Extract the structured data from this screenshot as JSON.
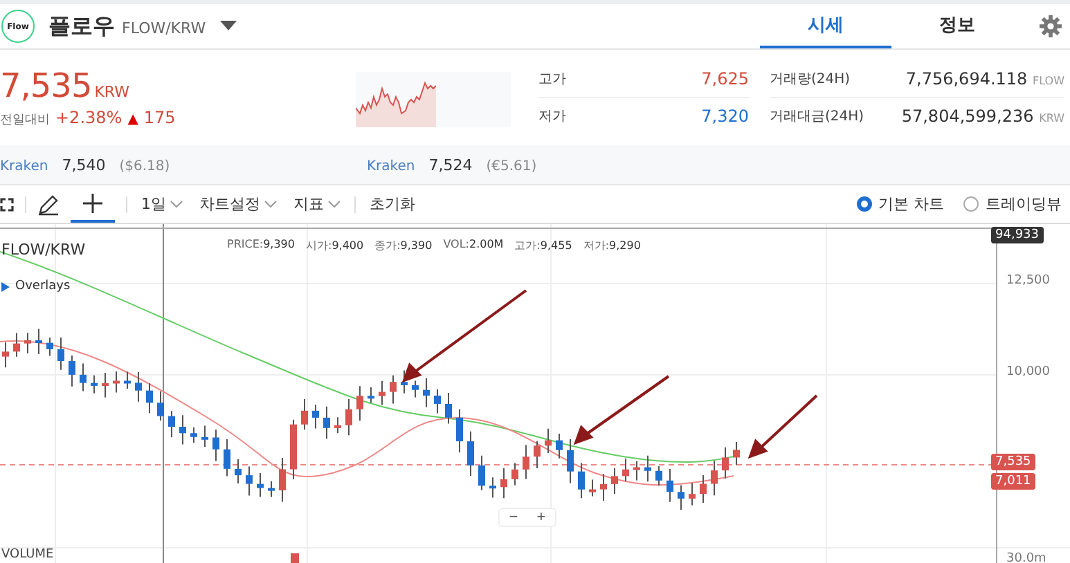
{
  "header": {
    "logo": "Flow",
    "name": "플로우",
    "pair": "FLOW/KRW"
  },
  "tabs": [
    {
      "label": "시세",
      "selected": true
    },
    {
      "label": "정보",
      "selected": false
    }
  ],
  "price": {
    "value": "7,535",
    "unit": "KRW",
    "change_label": "전일대비",
    "change_pct": "+2.38%",
    "change_arrow": "▲",
    "change_abs": "175"
  },
  "stats": [
    {
      "label": "고가",
      "value": "7,625",
      "color": "#d24b38",
      "label2": "거래량(24H)",
      "value2": "7,756,694.118",
      "unit2": "FLOW"
    },
    {
      "label": "저가",
      "value": "7,320",
      "color": "#1f6fd1",
      "label2": "거래대금(24H)",
      "value2": "57,804,599,236",
      "unit2": "KRW"
    }
  ],
  "exchanges": [
    {
      "name": "Kraken",
      "price": "7,540",
      "converted": "($6.18)"
    },
    {
      "name": "Kraken",
      "price": "7,524",
      "converted": "(€5.61)"
    }
  ],
  "toolbar": {
    "menus": [
      {
        "label": "1일"
      },
      {
        "label": "차트설정"
      },
      {
        "label": "지표"
      }
    ],
    "reset": "초기화",
    "views": [
      {
        "label": "기본 차트",
        "selected": true
      },
      {
        "label": "트레이딩뷰",
        "selected": false
      }
    ]
  },
  "chart": {
    "title": "FLOW/KRW",
    "overlays": "Overlays",
    "info": [
      {
        "label": "PRICE:",
        "value": "9,390"
      },
      {
        "label": "시가:",
        "value": "9,400"
      },
      {
        "label": "종가:",
        "value": "9,390"
      },
      {
        "label": "VOL:",
        "value": "2.00M"
      },
      {
        "label": "고가:",
        "value": "9,455"
      },
      {
        "label": "저가:",
        "value": "9,290"
      }
    ],
    "axis": [
      "12,500",
      "10,000",
      "30.0m"
    ],
    "tags": [
      {
        "label": "94,933",
        "color": "#333333"
      },
      {
        "label": "7,535",
        "color": "#d9534f"
      },
      {
        "label": "7,011",
        "color": "#d9534f"
      }
    ],
    "zoom": [
      "−",
      "+"
    ],
    "volume": "VOLUME"
  }
}
